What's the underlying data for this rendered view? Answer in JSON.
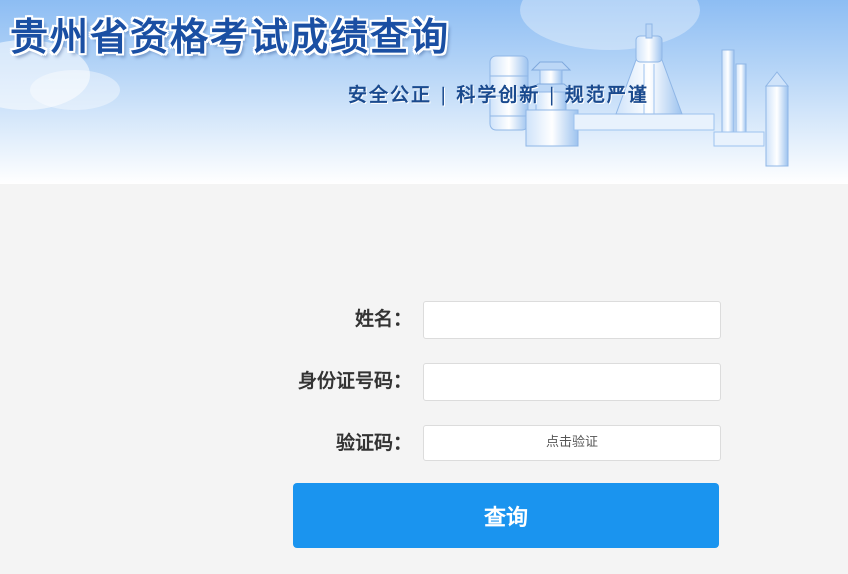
{
  "header": {
    "title": "贵州省资格考试成绩查询",
    "slogans": [
      "安全公正",
      "科学创新",
      "规范严谨"
    ],
    "separator": "|"
  },
  "form": {
    "name_label": "姓名：",
    "name_value": "",
    "id_label": "身份证号码：",
    "id_value": "",
    "captcha_label": "验证码：",
    "captcha_text": "点击验证",
    "submit_label": "查询"
  },
  "colors": {
    "title": "#1a4fa3",
    "button": "#1a94ef",
    "background": "#f4f4f4"
  }
}
